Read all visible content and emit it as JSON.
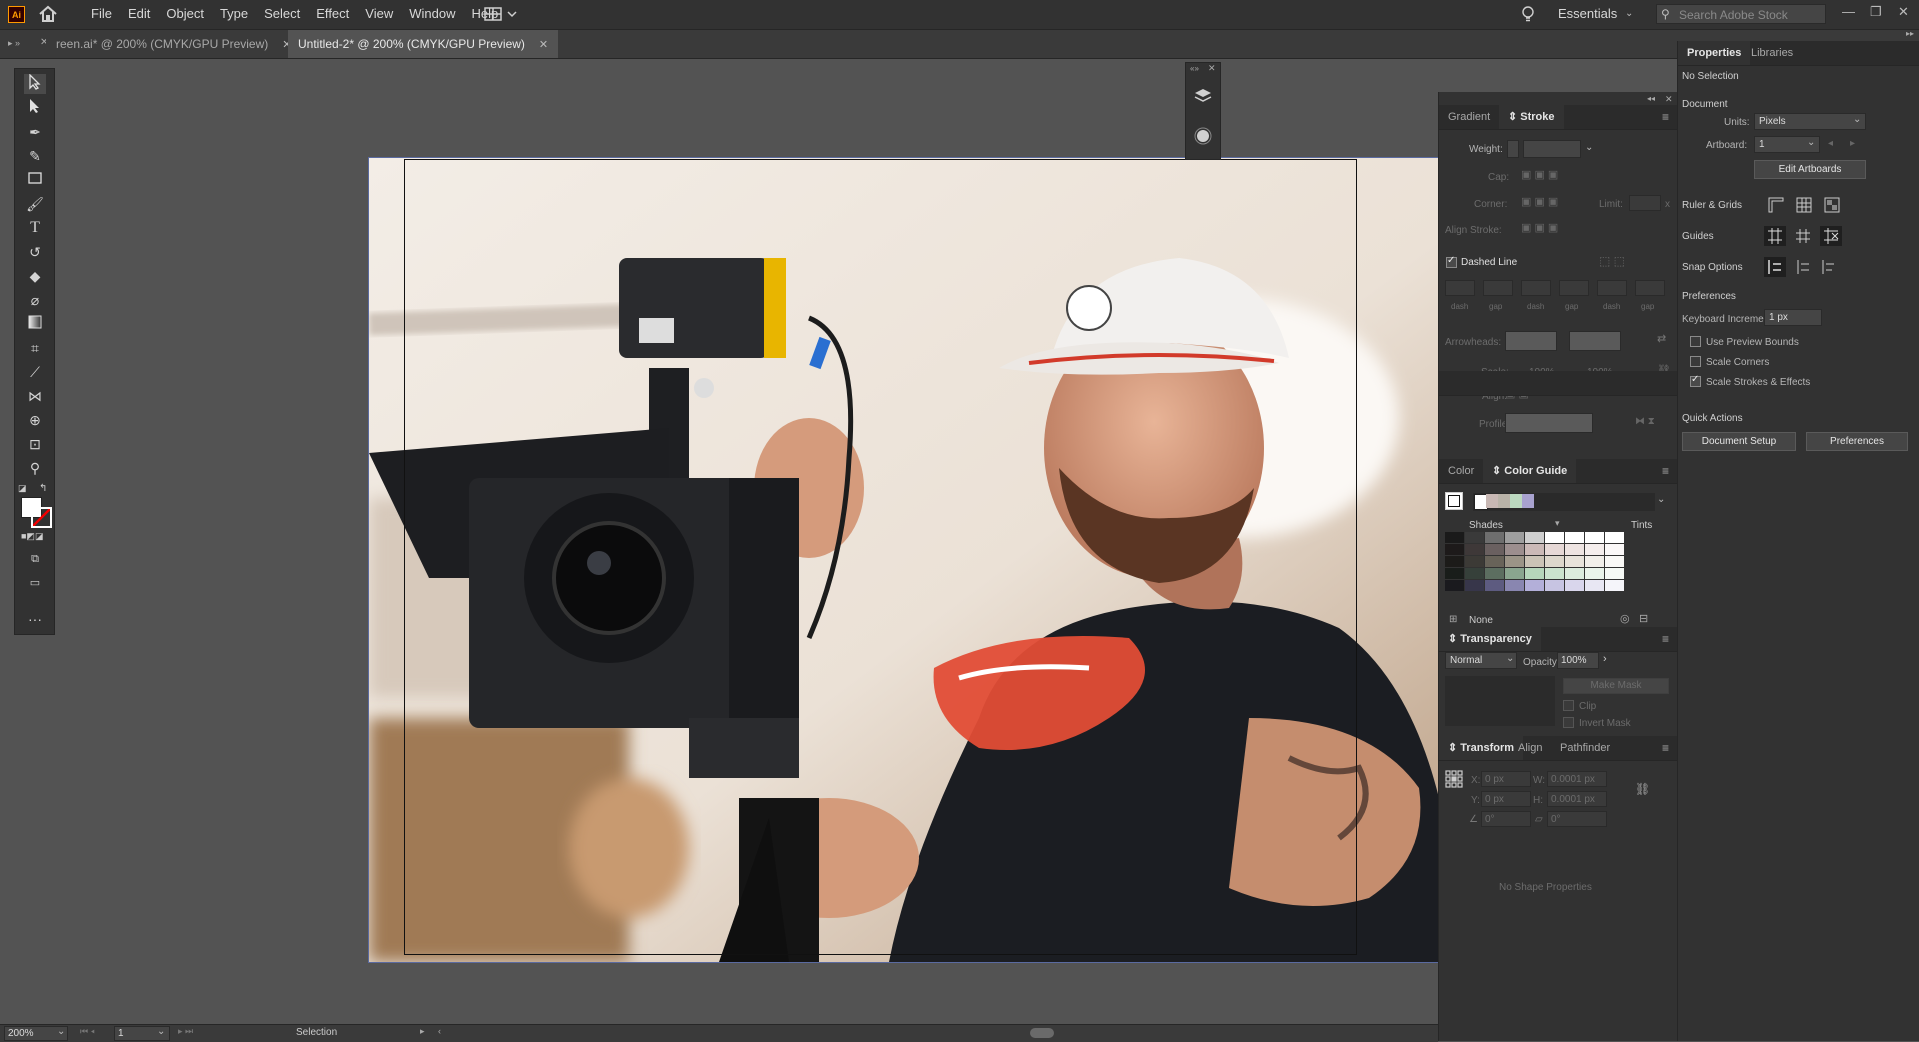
{
  "app": {
    "logo": "Ai",
    "menu": [
      "File",
      "Edit",
      "Object",
      "Type",
      "Select",
      "Effect",
      "View",
      "Window",
      "Help"
    ],
    "workspace": "Essentials",
    "search_placeholder": "Search Adobe Stock"
  },
  "tabs": [
    {
      "label": "reen.ai* @ 200% (CMYK/GPU Preview)",
      "active": false
    },
    {
      "label": "Untitled-2* @ 200% (CMYK/GPU Preview)",
      "active": true
    }
  ],
  "tools": [
    "selection-tool",
    "direct-selection-tool",
    "pen-tool",
    "curvature-tool",
    "rectangle-tool",
    "paintbrush-tool",
    "type-tool",
    "rotate-tool",
    "eraser-tool",
    "lasso-tool",
    "gradient-tool",
    "eyedropper-tool",
    "blend-tool",
    "width-tool",
    "shape-builder-tool",
    "artboard-tool",
    "zoom-tool"
  ],
  "stroke_panel": {
    "tabs": [
      "Gradient",
      "Stroke"
    ],
    "weight_label": "Weight:",
    "cap_label": "Cap:",
    "corner_label": "Corner:",
    "limit_label": "Limit:",
    "limit_suffix": "x",
    "align_label": "Align Stroke:",
    "dashed_label": "Dashed Line",
    "dash_labels": [
      "dash",
      "gap",
      "dash",
      "gap",
      "dash",
      "gap"
    ],
    "arrowheads_label": "Arrowheads:",
    "scale_label": "Scale:",
    "scale_values": [
      "100%",
      "100%"
    ],
    "align_label2": "Align:",
    "profile_label": "Profile:"
  },
  "color_guide": {
    "tabs": [
      "Color",
      "Color Guide"
    ],
    "shades_label": "Shades",
    "tints_label": "Tints",
    "none_label": "None",
    "harmony": [
      "#ffffff",
      "#c8b8b4",
      "#b9b3a8",
      "#bcd9c0",
      "#a8a2cf"
    ],
    "rows": [
      [
        "#1a1a1a",
        "#3a3a3a",
        "#6e6e6e",
        "#9e9e9e",
        "#cfcfcf",
        "#ffffff",
        "#ffffff",
        "#ffffff",
        "#ffffff"
      ],
      [
        "#1d1a1a",
        "#3e3838",
        "#6a6060",
        "#9c8e8e",
        "#cbb9b7",
        "#e6d8d6",
        "#eee4e2",
        "#f5eeed",
        "#fbf8f8"
      ],
      [
        "#1c1b19",
        "#3c3a36",
        "#686359",
        "#9b9487",
        "#cbc3b6",
        "#ddd7cc",
        "#e8e3db",
        "#f2efea",
        "#faf9f7"
      ],
      [
        "#191d1a",
        "#36403a",
        "#5c6e60",
        "#8aa58f",
        "#b6d6bb",
        "#cbe3ce",
        "#dcecde",
        "#eaf4eb",
        "#f6faf6"
      ],
      [
        "#1a1a1e",
        "#37364a",
        "#5d5b80",
        "#8986b0",
        "#b3afd9",
        "#c7c4e2",
        "#d9d6ec",
        "#e8e7f3",
        "#f5f5fa"
      ]
    ]
  },
  "transparency": {
    "title": "Transparency",
    "mode": "Normal",
    "opacity_label": "Opacity:",
    "opacity": "100%",
    "make_mask": "Make Mask",
    "clip": "Clip",
    "invert_mask": "Invert Mask"
  },
  "transform": {
    "tabs": [
      "Transform",
      "Align",
      "Pathfinder"
    ],
    "x_label": "X:",
    "x": "0 px",
    "y_label": "Y:",
    "y": "0 px",
    "w_label": "W:",
    "w": "0.0001 px",
    "h_label": "H:",
    "h": "0.0001 px",
    "angle": "0°",
    "shear": "0°",
    "no_shape": "No Shape Properties"
  },
  "properties": {
    "tabs": [
      "Properties",
      "Libraries"
    ],
    "no_selection": "No Selection",
    "document": "Document",
    "units_label": "Units:",
    "units": "Pixels",
    "artboard_label": "Artboard:",
    "artboard": "1",
    "edit_artboards": "Edit Artboards",
    "ruler_grids": "Ruler & Grids",
    "guides": "Guides",
    "snap_options": "Snap Options",
    "preferences_title": "Preferences",
    "keyboard_increment_label": "Keyboard Increment:",
    "keyboard_increment": "1 px",
    "use_preview_bounds": "Use Preview Bounds",
    "scale_corners": "Scale Corners",
    "scale_strokes": "Scale Strokes & Effects",
    "quick_actions": "Quick Actions",
    "document_setup": "Document Setup",
    "preferences_btn": "Preferences"
  },
  "status": {
    "zoom": "200%",
    "artboard": "1",
    "tool": "Selection"
  }
}
